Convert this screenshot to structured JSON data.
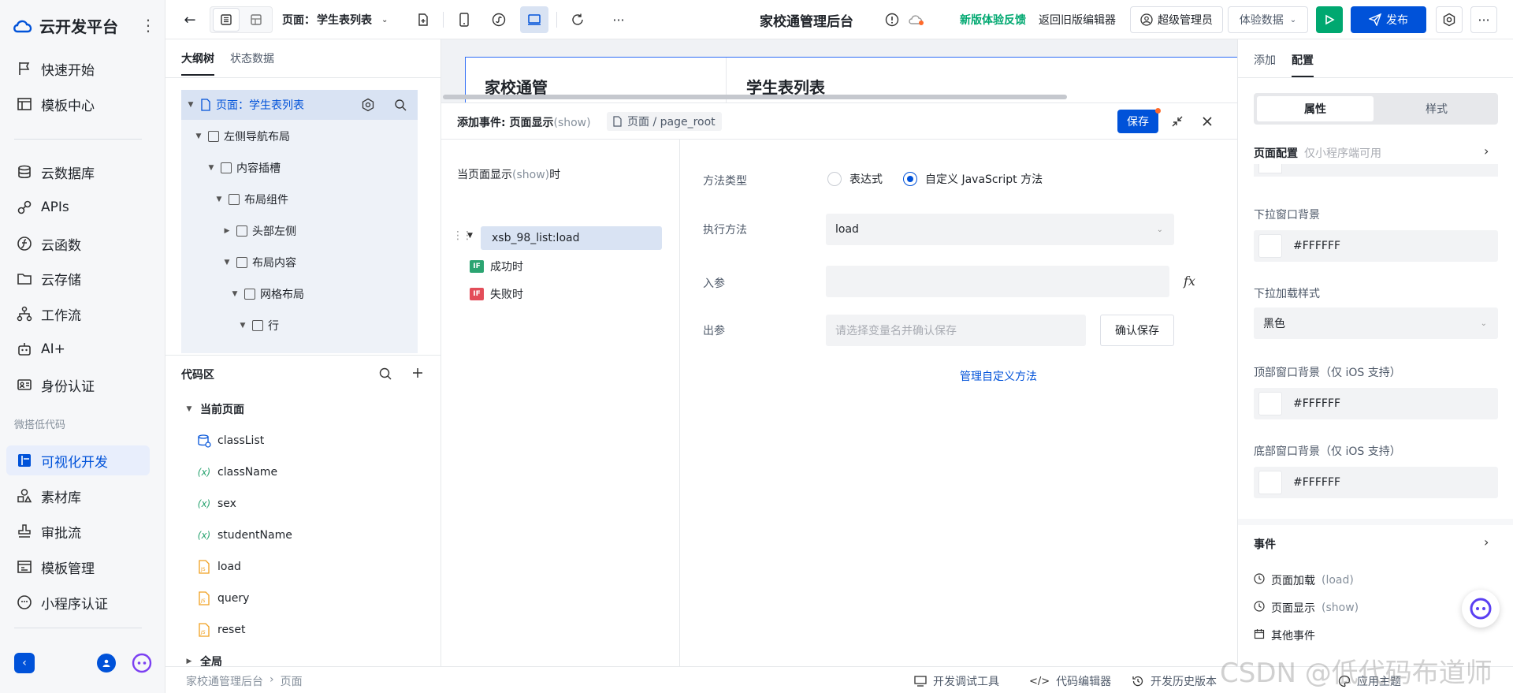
{
  "brand": {
    "name": "云开发平台"
  },
  "nav": {
    "quick_start": "快速开始",
    "template_center": "模板中心",
    "cloud_db": "云数据库",
    "apis": "APIs",
    "cloud_function": "云函数",
    "cloud_storage": "云存储",
    "workflow": "工作流",
    "ai": "AI+",
    "auth": "身份认证",
    "group_lowcode": "微搭低代码",
    "visual_dev": "可视化开发",
    "assets": "素材库",
    "approval": "审批流",
    "template_mgmt": "模板管理",
    "mini_auth": "小程序认证"
  },
  "topbar": {
    "page_prefix": "页面：",
    "page_name": "学生表列表",
    "app_title": "家校通管理后台",
    "feedback": "新版体验反馈",
    "back_old": "返回旧版编辑器",
    "admin": "超级管理员",
    "exp_data": "体验数据",
    "publish": "发布",
    "more": "···"
  },
  "outline": {
    "tab_tree": "大纲树",
    "tab_state": "状态数据",
    "nodes": [
      {
        "label": "页面：学生表列表"
      },
      {
        "label": "左侧导航布局"
      },
      {
        "label": "内容插槽"
      },
      {
        "label": "布局组件"
      },
      {
        "label": "头部左侧"
      },
      {
        "label": "布局内容"
      },
      {
        "label": "网格布局"
      },
      {
        "label": "行"
      }
    ]
  },
  "code": {
    "title": "代码区",
    "current_page": "当前页面",
    "items": [
      "classList",
      "className",
      "sex",
      "studentName",
      "load",
      "query",
      "reset"
    ],
    "global": "全局"
  },
  "canvas": {
    "heading_left": "家校通管",
    "heading_right": "学生表列表"
  },
  "event_panel": {
    "title_prefix": "添加事件: 页面显示",
    "title_suffix": "(show)",
    "crumb": "页面 / page_root",
    "save": "保存",
    "when_prefix": "当页面显示",
    "when_show": "(show)",
    "when_suffix": "时",
    "action": "xsb_98_list:load",
    "success": "成功时",
    "fail": "失败时",
    "if_badge": "IF"
  },
  "form": {
    "method_type_label": "方法类型",
    "opt_expression": "表达式",
    "opt_custom_js": "自定义 JavaScript 方法",
    "exec_label": "执行方法",
    "exec_value": "load",
    "input_label": "入参",
    "fx": "fx",
    "output_label": "出参",
    "output_placeholder": "请选择变量名并确认保存",
    "confirm_save": "确认保存",
    "manage_link": "管理自定义方法"
  },
  "right": {
    "tab_add": "添加",
    "tab_config": "配置",
    "seg_props": "属性",
    "seg_style": "样式",
    "page_config": "页面配置",
    "page_config_hint": "仅小程序端可用",
    "dropdown_bg": "下拉窗口背景",
    "dropdown_bg_value": "#FFFFFF",
    "dropdown_loading": "下拉加载样式",
    "dropdown_loading_value": "黑色",
    "top_bg": "顶部窗口背景（仅 iOS 支持）",
    "top_bg_value": "#FFFFFF",
    "bottom_bg": "底部窗口背景（仅 iOS 支持）",
    "bottom_bg_value": "#FFFFFF",
    "events": "事件",
    "ev_load": "页面加载",
    "ev_load_key": "(load)",
    "ev_show": "页面显示",
    "ev_show_key": "(show)",
    "ev_other": "其他事件"
  },
  "footer": {
    "crumb_app": "家校通管理后台",
    "crumb_page": "页面",
    "debug": "开发调试工具",
    "code_editor": "代码编辑器",
    "history": "开发历史版本",
    "theme": "应用主题"
  },
  "watermark": "CSDN @低代码布道师",
  "colors": {
    "primary": "#0052d9",
    "publish_green": "#00a870",
    "feedback_green": "#00a870",
    "if_success": "#2ba471",
    "if_fail": "#e34d59"
  }
}
